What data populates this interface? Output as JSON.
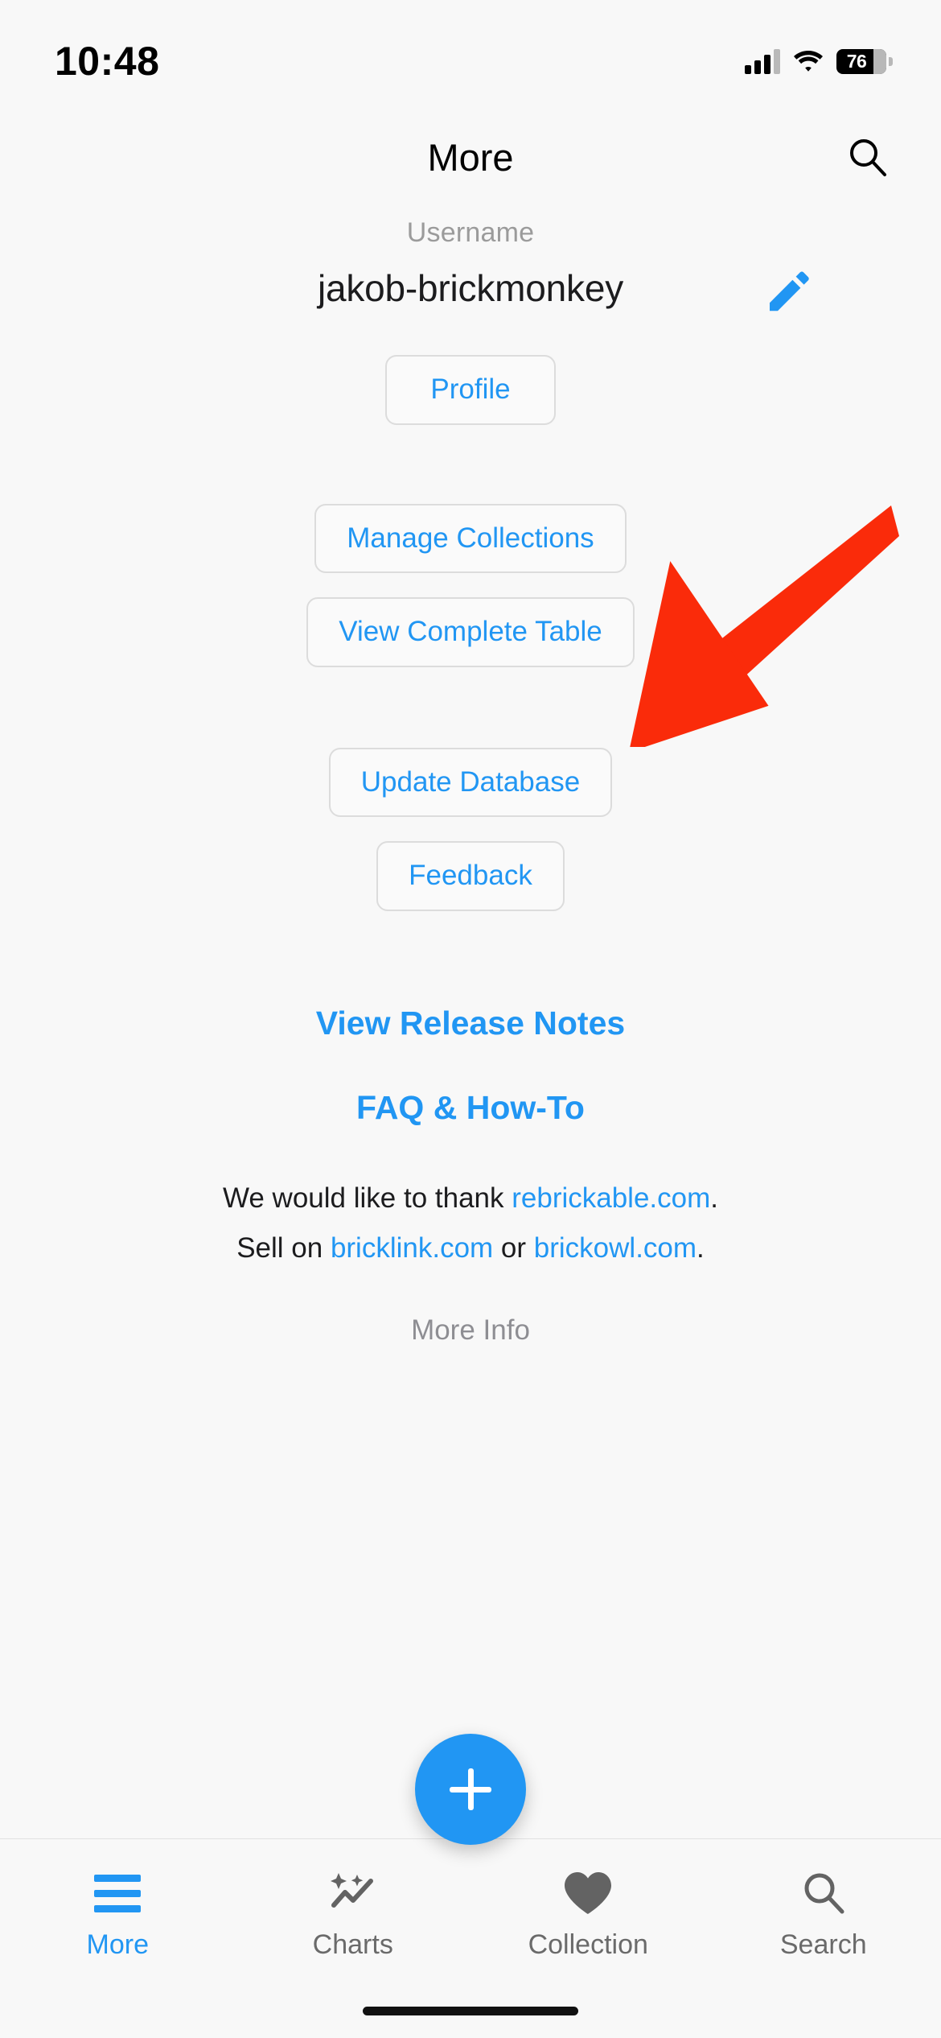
{
  "status_bar": {
    "time": "10:48",
    "battery_level": "76",
    "icons": [
      "cellular-signal-icon",
      "wifi-icon",
      "battery-icon"
    ]
  },
  "header": {
    "title": "More",
    "search_icon": "search-icon"
  },
  "profile": {
    "username_label": "Username",
    "username_value": "jakob-brickmonkey",
    "edit_icon": "pencil-icon",
    "profile_button": "Profile"
  },
  "collections_group": {
    "manage_collections_button": "Manage Collections",
    "view_complete_table_button": "View Complete Table"
  },
  "database_group": {
    "update_database_button": "Update Database",
    "feedback_button": "Feedback"
  },
  "links": {
    "release_notes": "View Release Notes",
    "faq": "FAQ & How-To"
  },
  "credits": {
    "thank_prefix": "We would like to thank ",
    "thank_link": "rebrickable.com",
    "thank_suffix": ".",
    "sell_prefix": "Sell on ",
    "sell_link_1": "bricklink.com",
    "sell_middle": " or ",
    "sell_link_2": "brickowl.com",
    "sell_suffix": ".",
    "more_info": "More Info"
  },
  "fab": {
    "label": "add-button",
    "icon": "plus-icon"
  },
  "tab_bar": {
    "items": [
      {
        "label": "More",
        "icon": "hamburger-menu-icon",
        "active": true
      },
      {
        "label": "Charts",
        "icon": "chart-sparkle-icon",
        "active": false
      },
      {
        "label": "Collection",
        "icon": "heart-icon",
        "active": false
      },
      {
        "label": "Search",
        "icon": "search-icon",
        "active": false
      }
    ]
  },
  "annotation": {
    "arrow": "red-arrow-pointing-to-view-complete-table",
    "color": "#FA2B0A"
  },
  "colors": {
    "accent_blue": "#2196F3",
    "background": "#F8F8F8",
    "border_gray": "#DCDCDC",
    "muted_text": "#8E8E93",
    "annotation_red": "#FA2B0A"
  }
}
